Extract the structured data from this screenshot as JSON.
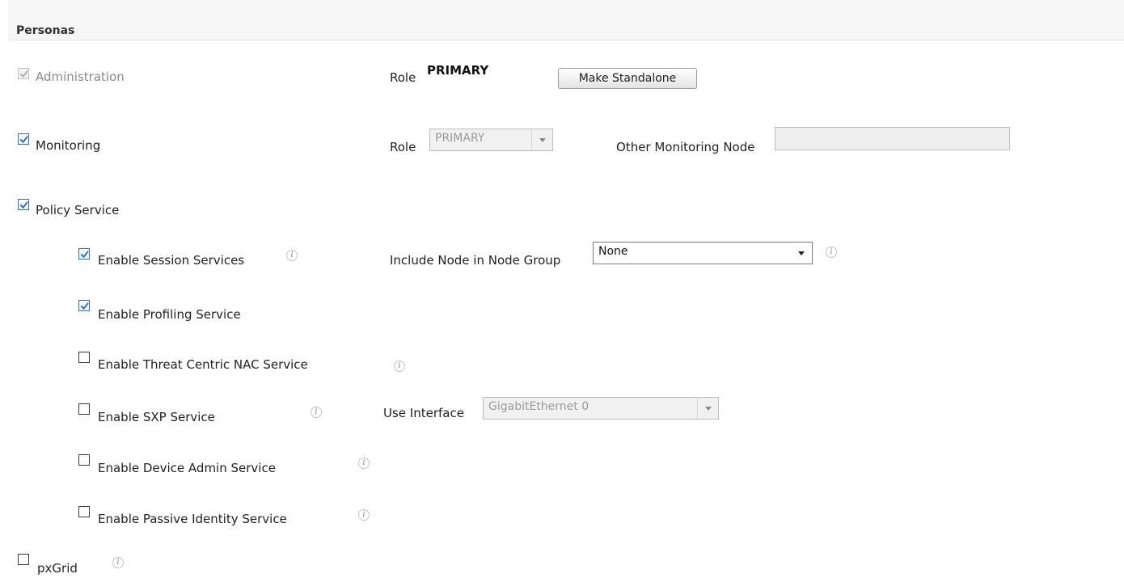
{
  "section": {
    "title": "Personas"
  },
  "personas": {
    "administration": {
      "label": "Administration",
      "checked": true,
      "disabled": true,
      "role_label": "Role",
      "role_value": "PRIMARY",
      "button_label": "Make Standalone"
    },
    "monitoring": {
      "label": "Monitoring",
      "checked": true,
      "role_label": "Role",
      "role_select_value": "PRIMARY",
      "other_node_label": "Other Monitoring Node",
      "other_node_value": ""
    },
    "policy_service": {
      "label": "Policy Service",
      "checked": true
    },
    "session_services": {
      "label": "Enable Session Services",
      "checked": true,
      "node_group_label": "Include Node in Node Group",
      "node_group_value": "None"
    },
    "profiling_service": {
      "label": "Enable Profiling Service",
      "checked": true
    },
    "threat_centric": {
      "label": "Enable Threat Centric NAC Service",
      "checked": false
    },
    "sxp_service": {
      "label": "Enable SXP Service",
      "checked": false,
      "interface_label": "Use Interface",
      "interface_value": "GigabitEthernet 0"
    },
    "device_admin": {
      "label": "Enable Device Admin Service",
      "checked": false
    },
    "passive_identity": {
      "label": "Enable Passive Identity Service",
      "checked": false
    },
    "pxgrid": {
      "label": "pxGrid",
      "checked": false
    }
  },
  "info_icon_glyph": "i",
  "colors": {
    "checkmark": "#2a6db5",
    "checkmark_disabled": "#a9a9a9"
  }
}
